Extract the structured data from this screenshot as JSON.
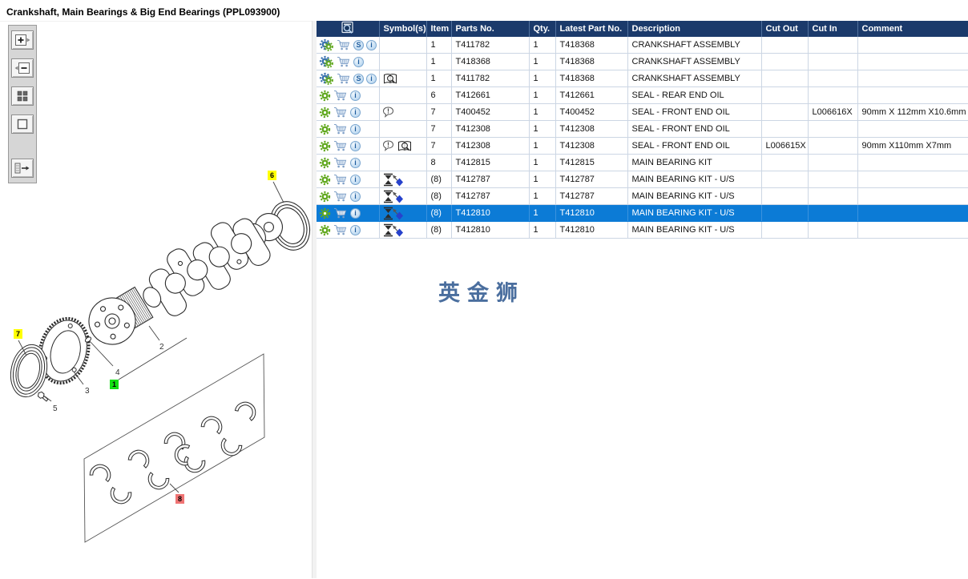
{
  "window": {
    "title": "Crankshaft, Main Bearings & Big End Bearings (PPL093900)"
  },
  "watermark": {
    "text": "英金狮",
    "color": "#4a6e9e"
  },
  "viewer_toolbar": {
    "buttons": [
      {
        "name": "zoom-in-button",
        "icon": "zoom-in-icon"
      },
      {
        "name": "zoom-out-button",
        "icon": "zoom-out-icon"
      },
      {
        "name": "tile-view-button",
        "icon": "tile-grid-icon"
      },
      {
        "name": "zoom-box-button",
        "icon": "selection-box-icon"
      },
      {
        "name": "toggle-panel-button",
        "icon": "panel-arrow-icon"
      }
    ]
  },
  "diagram": {
    "callouts": [
      {
        "text": "6",
        "highlight": "yellow"
      },
      {
        "text": "7",
        "highlight": "yellow"
      },
      {
        "text": "2",
        "highlight": "none"
      },
      {
        "text": "4",
        "highlight": "none"
      },
      {
        "text": "1",
        "highlight": "green"
      },
      {
        "text": "3",
        "highlight": "none"
      },
      {
        "text": "5",
        "highlight": "none"
      },
      {
        "text": "8",
        "highlight": "red"
      }
    ]
  },
  "table": {
    "columns": [
      {
        "id": "actions",
        "label": ""
      },
      {
        "id": "symbols",
        "label": "Symbol(s)"
      },
      {
        "id": "item",
        "label": "Item"
      },
      {
        "id": "parts_no",
        "label": "Parts No."
      },
      {
        "id": "qty",
        "label": "Qty."
      },
      {
        "id": "latest",
        "label": "Latest Part No."
      },
      {
        "id": "description",
        "label": "Description"
      },
      {
        "id": "cut_out",
        "label": "Cut Out"
      },
      {
        "id": "cut_in",
        "label": "Cut In"
      },
      {
        "id": "comment",
        "label": "Comment"
      }
    ],
    "rows": [
      {
        "icons": [
          "gear-double",
          "cart",
          "s-badge",
          "info"
        ],
        "symbols": [],
        "item": "1",
        "parts_no": "T411782",
        "qty": "1",
        "latest": "T418368",
        "description": "CRANKSHAFT ASSEMBLY",
        "cut_out": "",
        "cut_in": "",
        "comment": "",
        "selected": false
      },
      {
        "icons": [
          "gear-double",
          "cart",
          "info"
        ],
        "symbols": [],
        "item": "1",
        "parts_no": "T418368",
        "qty": "1",
        "latest": "T418368",
        "description": "CRANKSHAFT ASSEMBLY",
        "cut_out": "",
        "cut_in": "",
        "comment": "",
        "selected": false
      },
      {
        "icons": [
          "gear-double",
          "cart",
          "s-badge",
          "info"
        ],
        "symbols": [
          "book-search"
        ],
        "item": "1",
        "parts_no": "T411782",
        "qty": "1",
        "latest": "T418368",
        "description": "CRANKSHAFT ASSEMBLY",
        "cut_out": "",
        "cut_in": "",
        "comment": "",
        "selected": false
      },
      {
        "icons": [
          "gear",
          "cart",
          "info"
        ],
        "symbols": [],
        "item": "6",
        "parts_no": "T412661",
        "qty": "1",
        "latest": "T412661",
        "description": "SEAL - REAR END OIL",
        "cut_out": "",
        "cut_in": "",
        "comment": "",
        "selected": false
      },
      {
        "icons": [
          "gear",
          "cart",
          "info"
        ],
        "symbols": [
          "note-bubble"
        ],
        "item": "7",
        "parts_no": "T400452",
        "qty": "1",
        "latest": "T400452",
        "description": "SEAL - FRONT END OIL",
        "cut_out": "",
        "cut_in": "L006616X",
        "comment": "90mm X 112mm X10.6mm",
        "selected": false
      },
      {
        "icons": [
          "gear",
          "cart",
          "info"
        ],
        "symbols": [],
        "item": "7",
        "parts_no": "T412308",
        "qty": "1",
        "latest": "T412308",
        "description": "SEAL - FRONT END OIL",
        "cut_out": "",
        "cut_in": "",
        "comment": "",
        "selected": false
      },
      {
        "icons": [
          "gear",
          "cart",
          "info"
        ],
        "symbols": [
          "note-bubble",
          "book-search"
        ],
        "item": "7",
        "parts_no": "T412308",
        "qty": "1",
        "latest": "T412308",
        "description": "SEAL - FRONT END OIL",
        "cut_out": "L006615X",
        "cut_in": "",
        "comment": "90mm X110mm X7mm",
        "selected": false
      },
      {
        "icons": [
          "gear",
          "cart",
          "info"
        ],
        "symbols": [],
        "item": "8",
        "parts_no": "T412815",
        "qty": "1",
        "latest": "T412815",
        "description": "MAIN BEARING KIT",
        "cut_out": "",
        "cut_in": "",
        "comment": "",
        "selected": false
      },
      {
        "icons": [
          "gear",
          "cart",
          "info"
        ],
        "symbols": [
          "bearing-undersize"
        ],
        "item": "(8)",
        "parts_no": "T412787",
        "qty": "1",
        "latest": "T412787",
        "description": "MAIN BEARING KIT - U/S",
        "cut_out": "",
        "cut_in": "",
        "comment": "",
        "selected": false
      },
      {
        "icons": [
          "gear",
          "cart",
          "info"
        ],
        "symbols": [
          "bearing-undersize"
        ],
        "item": "(8)",
        "parts_no": "T412787",
        "qty": "1",
        "latest": "T412787",
        "description": "MAIN BEARING KIT - U/S",
        "cut_out": "",
        "cut_in": "",
        "comment": "",
        "selected": false
      },
      {
        "icons": [
          "gear",
          "cart",
          "info"
        ],
        "symbols": [
          "bearing-undersize"
        ],
        "item": "(8)",
        "parts_no": "T412810",
        "qty": "1",
        "latest": "T412810",
        "description": "MAIN BEARING KIT - U/S",
        "cut_out": "",
        "cut_in": "",
        "comment": "",
        "selected": true
      },
      {
        "icons": [
          "gear",
          "cart",
          "info"
        ],
        "symbols": [
          "bearing-undersize"
        ],
        "item": "(8)",
        "parts_no": "T412810",
        "qty": "1",
        "latest": "T412810",
        "description": "MAIN BEARING KIT - U/S",
        "cut_out": "",
        "cut_in": "",
        "comment": "",
        "selected": false
      }
    ]
  },
  "colors": {
    "header_bg": "#1b3a6b",
    "selected_row_bg": "#0c7bd6",
    "grid_line": "#ccd6e4",
    "gear_green": "#61a81f",
    "gear_blue": "#3a72b0",
    "cart_blue": "#7e9fc7",
    "watermark_blue": "#4a6e9e",
    "callout_yellow": "#ffff00",
    "callout_green": "#12e012",
    "callout_red": "#f07474"
  }
}
